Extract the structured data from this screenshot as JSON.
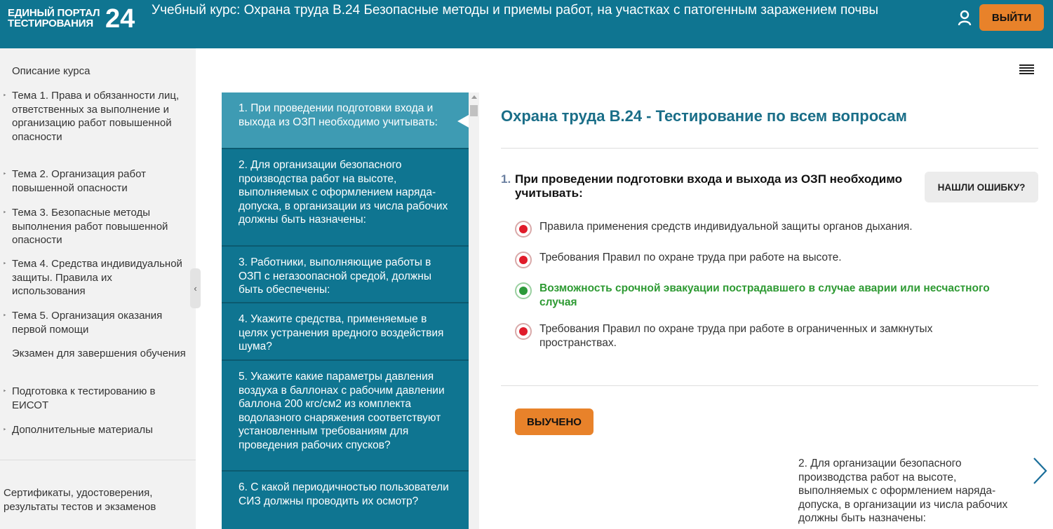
{
  "header": {
    "logo_line1": "ЕДИНЫЙ ПОРТАЛ",
    "logo_line2": "ТЕСТИРОВАНИЯ",
    "logo_number": "24",
    "course_title": "Учебный курс: Охрана труда В.24 Безопасные методы и приемы работ, на участках с патогенным заражением почвы",
    "logout_label": "ВЫЙТИ",
    "user_icon": "user-icon",
    "accent_color": "#0f7591",
    "button_color": "#e8822a"
  },
  "sidebar": {
    "items": [
      {
        "label": "Описание курса",
        "arrow": ""
      },
      {
        "label": "Тема 1. Права и обязанности лиц, ответственных за выполнение и организацию работ повышенной опасности",
        "arrow": "‣"
      },
      {
        "label": "Тема 2. Организация работ повышенной опасности",
        "arrow": "‣"
      },
      {
        "label": "Тема 3. Безопасные методы выполнения работ повышенной опасности",
        "arrow": "‣"
      },
      {
        "label": "Тема 4. Средства индивидуальной защиты. Правила их использования",
        "arrow": "‣"
      },
      {
        "label": "Тема 5. Организация оказания первой помощи",
        "arrow": "‣"
      },
      {
        "label": "Экзамен для завершения обучения",
        "arrow": ""
      },
      {
        "label": "Подготовка к тестированию в ЕИСОТ",
        "arrow": "‣"
      },
      {
        "label": "Дополнительные материалы",
        "arrow": "‣"
      }
    ],
    "certificates": "Сертификаты, удостоверения, результаты тестов и экзаменов",
    "collapse_icon": "chevron-left-icon"
  },
  "question_list": [
    "1. При проведении подготовки входа и выхода из ОЗП необходимо учитывать:",
    "2. Для организации безопасного производства работ на высоте, выполняемых с оформлением наряда-допуска, в организации из числа рабочих должны быть назначены:",
    "3. Работники, выполняющие работы в ОЗП с негазоопасной средой, должны быть обеспечены:",
    "4. Укажите средства, применяемые в целях устранения вредного воздействия шума?",
    "5. Укажите какие параметры давления воздуха в баллонах с рабочим давлении баллона 200 кгс/см2 из комплекта водолазного снаряжения соответствуют установленным требованиям для проведения рабочих спусков?",
    "6. С какой периодичностью пользователи СИЗ должны проводить их осмотр?"
  ],
  "main": {
    "section_title": "Охрана труда В.24 - Тестирование по всем вопросам",
    "question_number": "1.",
    "question_text": "При проведении подготовки входа и выхода из ОЗП необходимо учитывать:",
    "report_button": "НАШЛИ ОШИБКУ?",
    "answers": [
      {
        "text": "Правила применения средств индивидуальной защиты органов дыхания.",
        "correct": false
      },
      {
        "text": "Требования Правил по охране труда при работе на высоте.",
        "correct": false
      },
      {
        "text": "Возможность срочной эвакуации пострадавшего в случае аварии или несчастного случая",
        "correct": true
      },
      {
        "text": "Требования Правил по охране труда при работе в ограниченных и замкнутых пространствах.",
        "correct": false
      }
    ],
    "learned_button": "ВЫУЧЕНО",
    "next_question_text": "2. Для организации безопасного производства работ на высоте, выполняемых с оформлением наряда-допуска, в организации из числа рабочих должны быть назначены:",
    "next_icon": "chevron-right-icon",
    "menu_icon": "hamburger-menu-icon",
    "correct_color": "#2e9a33",
    "wrong_color": "#e01b2a"
  }
}
